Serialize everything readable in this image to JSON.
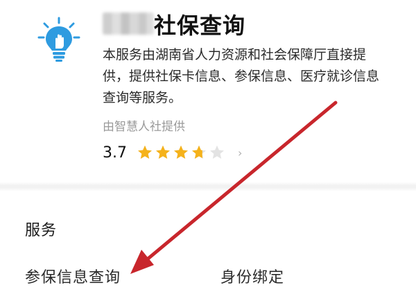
{
  "app": {
    "icon": "lightbulb-hand-icon",
    "title": "社保查询",
    "description": "本服务由湖南省人力资源和社会保障厅直接提供，提供社保卡信息、参保信息、医疗就诊信息查询等服务。",
    "provider": "由智慧人社提供",
    "rating": {
      "value": "3.7",
      "score": 3.7,
      "max": 5
    }
  },
  "services": {
    "title": "服务",
    "items": [
      {
        "label": "参保信息查询"
      },
      {
        "label": "身份绑定"
      }
    ]
  },
  "colors": {
    "icon_blue": "#2e9be0",
    "star_gold": "#f5b21b",
    "star_empty": "#e3e3e3",
    "arrow_red": "#c8262c",
    "muted_text": "#9a9a9a"
  }
}
